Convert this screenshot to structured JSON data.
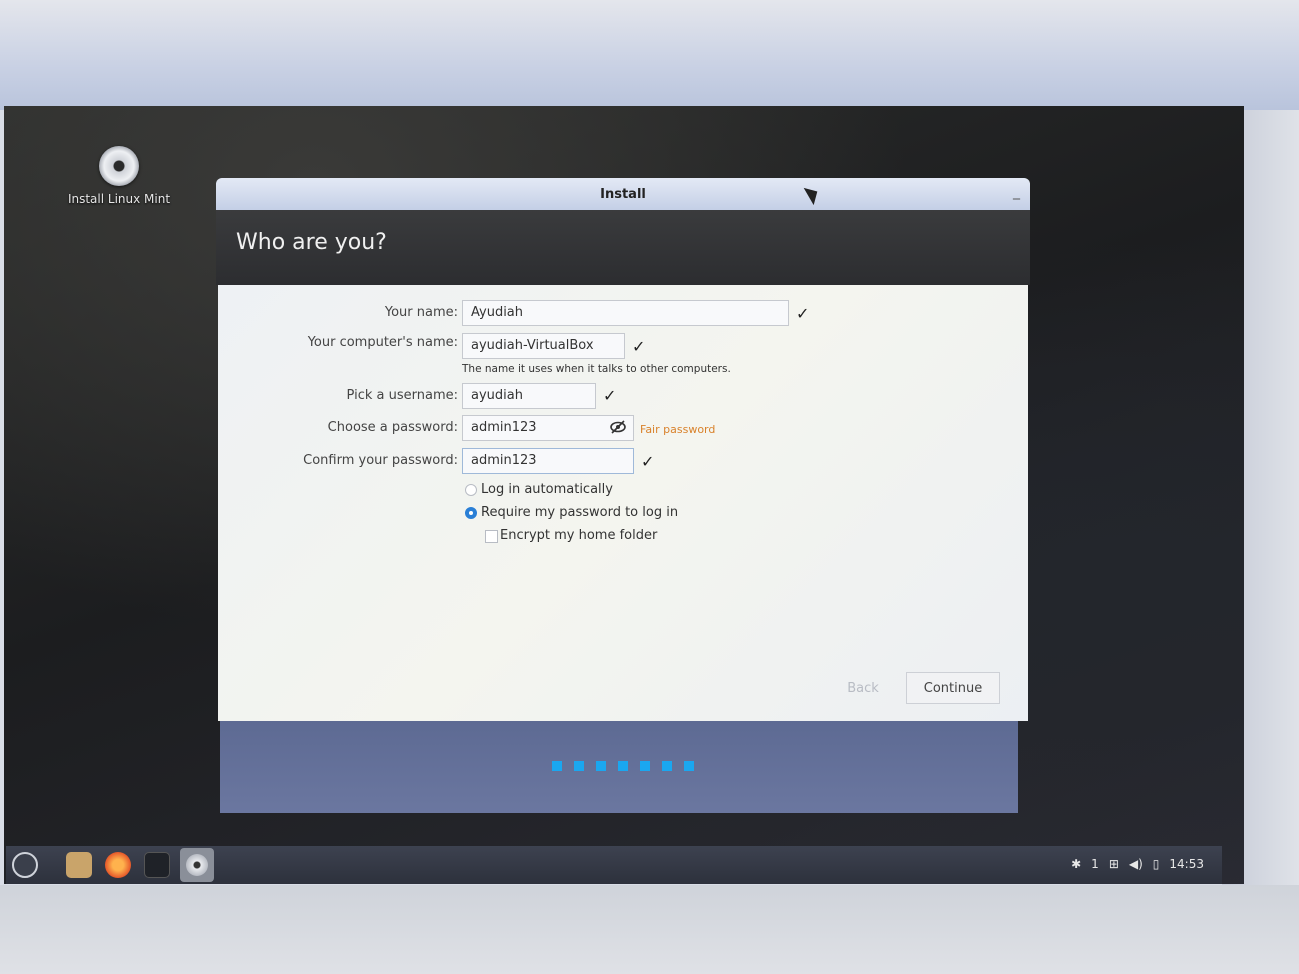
{
  "desktop": {
    "icon_label": "Install Linux Mint"
  },
  "window": {
    "title": "Install",
    "minimize": "_"
  },
  "page": {
    "heading": "Who are you?"
  },
  "form": {
    "name_label": "Your name:",
    "name_value": "Ayudiah",
    "computer_label": "Your computer's name:",
    "computer_value": "ayudiah-VirtualBox",
    "computer_hint": "The name it uses when it talks to other computers.",
    "username_label": "Pick a username:",
    "username_value": "ayudiah",
    "password_label": "Choose a password:",
    "password_value": "admin123",
    "password_strength": "Fair password",
    "confirm_label": "Confirm your password:",
    "confirm_value": "admin123",
    "check_mark": "✓"
  },
  "login_options": {
    "auto_login": "Log in automatically",
    "require_password": "Require my password to log in",
    "encrypt_home": "Encrypt my home folder",
    "selected": "require_password"
  },
  "buttons": {
    "back": "Back",
    "continue": "Continue"
  },
  "progress": {
    "steps": 7,
    "accent": "#1aa7f0"
  },
  "taskbar": {
    "apps": [
      "mint-menu-icon",
      "files-icon",
      "firefox-icon",
      "terminal-icon",
      "installer-icon"
    ],
    "tray_notifications": "1",
    "clock": "14:53"
  }
}
